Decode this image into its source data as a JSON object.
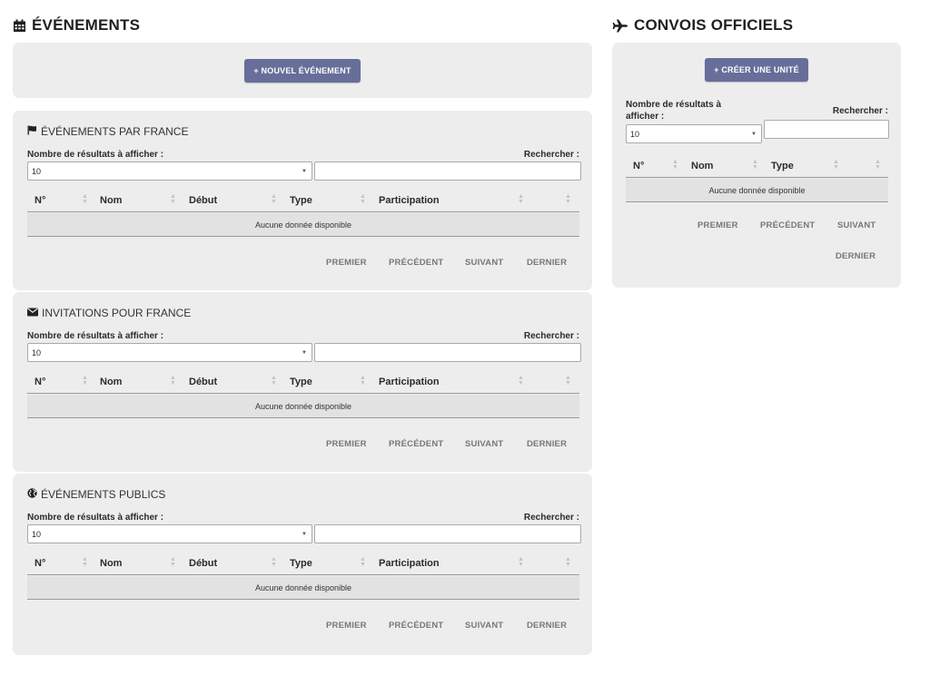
{
  "events": {
    "title": "ÉVÉNEMENTS",
    "new_button": "+ NOUVEL ÉVÉNEMENT",
    "sections": [
      {
        "title": "ÉVÉNEMENTS PAR FRANCE",
        "icon": "flag-icon",
        "length_label": "Nombre de résultats à afficher :",
        "length_value": "10",
        "search_label": "Rechercher :",
        "columns": [
          "N°",
          "Nom",
          "Début",
          "Type",
          "Participation"
        ],
        "empty_text": "Aucune donnée disponible",
        "pagination": [
          "PREMIER",
          "PRÉCÉDENT",
          "SUIVANT",
          "DERNIER"
        ]
      },
      {
        "title": "INVITATIONS POUR FRANCE",
        "icon": "envelope-icon",
        "length_label": "Nombre de résultats à afficher :",
        "length_value": "10",
        "search_label": "Rechercher :",
        "columns": [
          "N°",
          "Nom",
          "Début",
          "Type",
          "Participation"
        ],
        "empty_text": "Aucune donnée disponible",
        "pagination": [
          "PREMIER",
          "PRÉCÉDENT",
          "SUIVANT",
          "DERNIER"
        ]
      },
      {
        "title": "ÉVÉNEMENTS PUBLICS",
        "icon": "globe-icon",
        "length_label": "Nombre de résultats à afficher :",
        "length_value": "10",
        "search_label": "Rechercher :",
        "columns": [
          "N°",
          "Nom",
          "Début",
          "Type",
          "Participation"
        ],
        "empty_text": "Aucune donnée disponible",
        "pagination": [
          "PREMIER",
          "PRÉCÉDENT",
          "SUIVANT",
          "DERNIER"
        ]
      }
    ]
  },
  "convoys": {
    "title": "CONVOIS OFFICIELS",
    "create_button": "+ CRÉER UNE UNITÉ",
    "length_label_1": "Nombre de résultats à",
    "length_label_2": "afficher :",
    "length_value": "10",
    "search_label": "Rechercher :",
    "columns": [
      "N°",
      "Nom",
      "Type"
    ],
    "empty_text": "Aucune donnée disponible",
    "pagination": [
      "PREMIER",
      "PRÉCÉDENT",
      "SUIVANT",
      "DERNIER"
    ]
  },
  "colors": {
    "card_bg": "#ededed",
    "button_bg": "#676e9a",
    "empty_row_bg": "#e2e2e2"
  }
}
